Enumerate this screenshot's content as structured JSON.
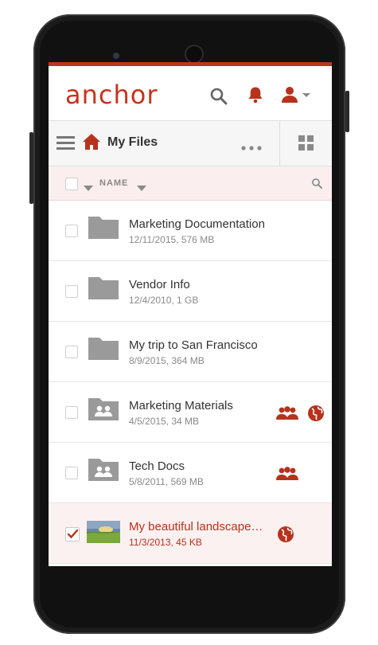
{
  "brand": {
    "logo_text": "anchor",
    "accent": "#c5341c"
  },
  "toolbar": {
    "title": "My Files"
  },
  "list_header": {
    "column": "NAME"
  },
  "files": [
    {
      "name": "Marketing Documentation",
      "meta": "12/11/2015, 576 MB",
      "type": "folder",
      "shared_group": false,
      "public": false,
      "selected": false
    },
    {
      "name": "Vendor Info",
      "meta": "12/4/2010, 1 GB",
      "type": "folder",
      "shared_group": false,
      "public": false,
      "selected": false
    },
    {
      "name": "My trip to San Francisco",
      "meta": "8/9/2015, 364 MB",
      "type": "folder",
      "shared_group": false,
      "public": false,
      "selected": false
    },
    {
      "name": "Marketing Materials",
      "meta": "4/5/2015, 34 MB",
      "type": "shared-folder",
      "shared_group": true,
      "public": true,
      "selected": false
    },
    {
      "name": "Tech Docs",
      "meta": "5/8/2011, 569 MB",
      "type": "shared-folder",
      "shared_group": true,
      "public": false,
      "selected": false
    },
    {
      "name": "My beautiful landscape…",
      "meta": "11/3/2013, 45 KB",
      "type": "image",
      "shared_group": false,
      "public": true,
      "selected": true
    }
  ]
}
